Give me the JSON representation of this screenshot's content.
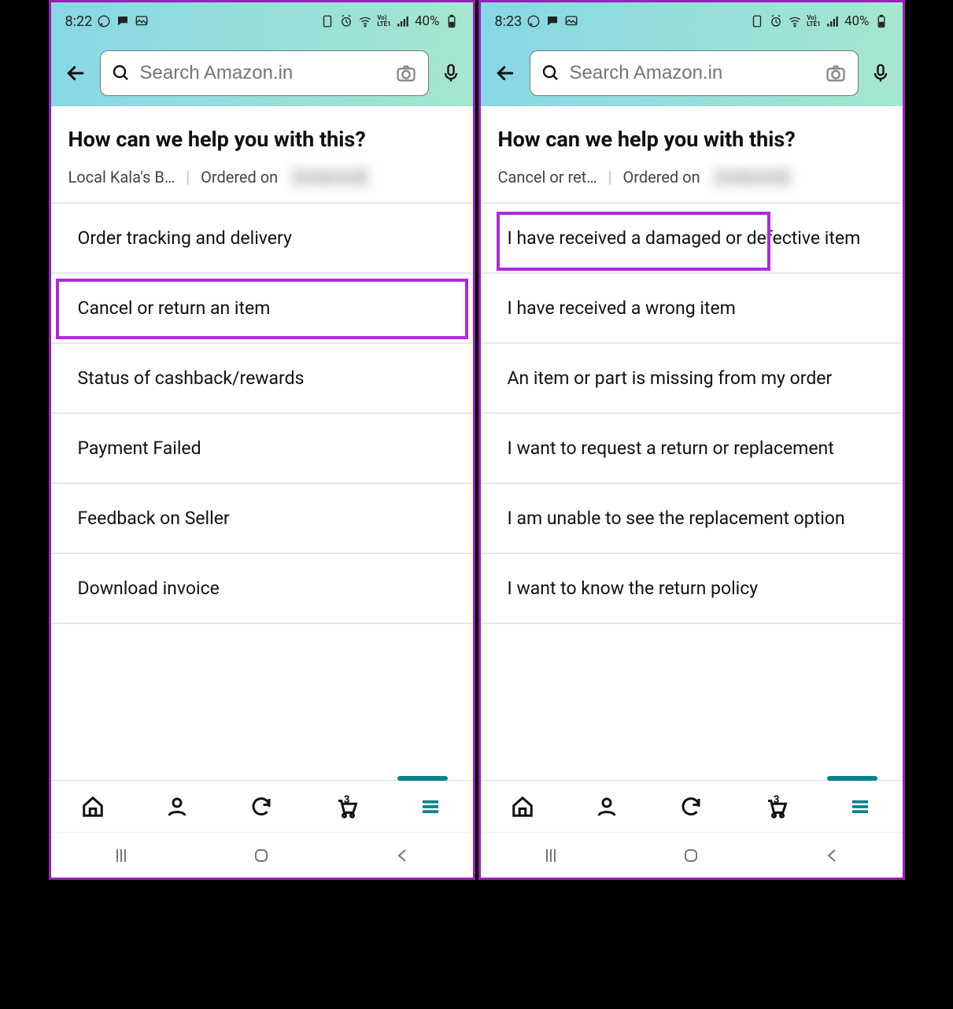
{
  "left": {
    "status": {
      "time": "8:22",
      "battery": "40%"
    },
    "search": {
      "placeholder": "Search Amazon.in"
    },
    "title": "How can we help you with this?",
    "context": {
      "item": "Local Kala's B…",
      "ordered_label": "Ordered on",
      "ordered_value": "[redacted]"
    },
    "options": [
      "Order tracking and delivery",
      "Cancel or return an item",
      "Status of cashback/rewards",
      "Payment Failed",
      "Feedback on Seller",
      "Download invoice"
    ],
    "highlight_index": 1,
    "cart_count": "3"
  },
  "right": {
    "status": {
      "time": "8:23",
      "battery": "40%"
    },
    "search": {
      "placeholder": "Search Amazon.in"
    },
    "title": "How can we help you with this?",
    "context": {
      "item": "Cancel or ret…",
      "ordered_label": "Ordered on",
      "ordered_value": "[redacted]"
    },
    "options": [
      "I have received a damaged or defective item",
      "I have received a wrong item",
      "An item or part is missing from my order",
      "I want to request a return or replacement",
      "I am unable to see the replacement option",
      "I want to know the return policy"
    ],
    "highlight_index": 0,
    "cart_count": "3"
  }
}
